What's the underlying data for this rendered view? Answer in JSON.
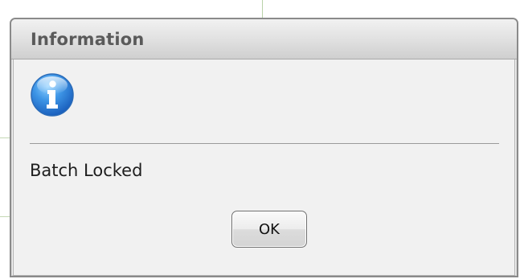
{
  "dialog": {
    "title": "Information",
    "icon": "information-icon",
    "message": "Batch Locked",
    "ok_label": "OK"
  },
  "colors": {
    "icon_blue": "#2e7fd8",
    "titlebar_text": "#5a5a5a",
    "dialog_background": "#f0f0f0"
  }
}
